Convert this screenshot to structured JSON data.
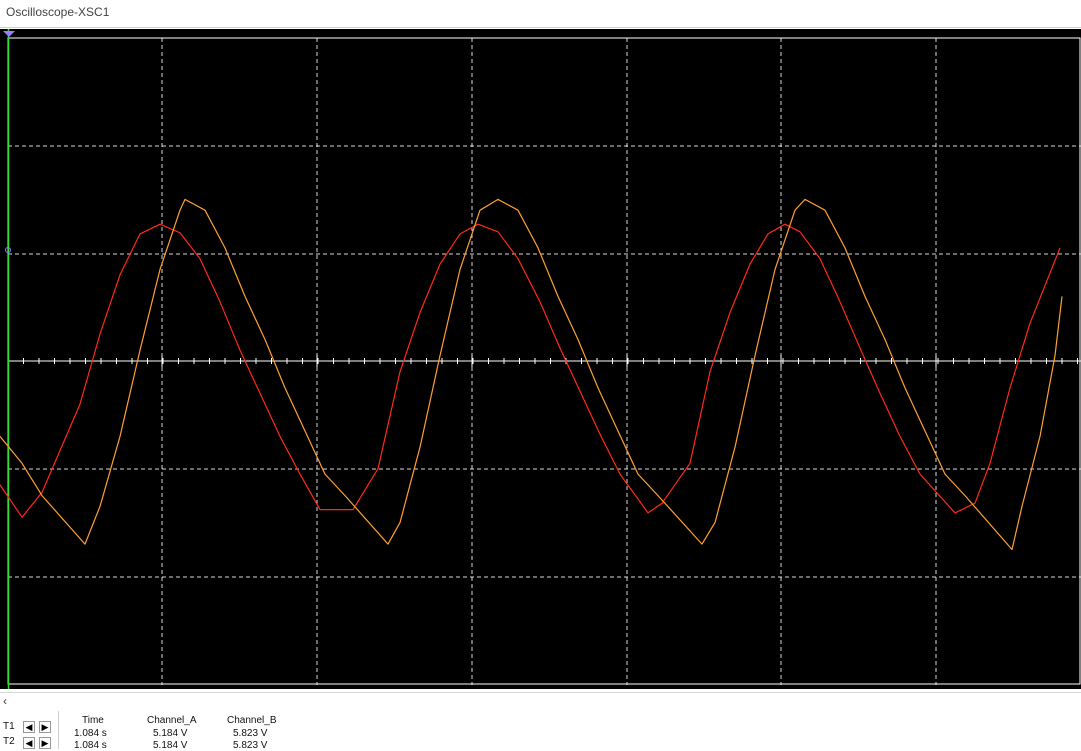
{
  "window": {
    "title": "Oscilloscope-XSC1"
  },
  "scope": {
    "background": "#000000",
    "grid_color": "#ffffff",
    "trace_a_color": "#ff2a1a",
    "trace_b_color": "#ffa030",
    "cursor_t1_color": "#33dd33",
    "trigger_marker_color": "#9a7dff"
  },
  "chart_data": {
    "type": "line",
    "grid": true,
    "divisions": {
      "x": 7,
      "y": 6
    },
    "series": [
      {
        "values": [
          -1.15,
          -1.45,
          -1.22,
          -0.4,
          0.25,
          0.8,
          1.18,
          1.27,
          1.19,
          0.95,
          0.55,
          0.1,
          -0.3,
          -0.7,
          -1.05,
          -1.38,
          -1.38,
          -1.0,
          -0.1,
          0.45,
          0.9,
          1.18,
          1.27,
          1.2,
          0.95,
          0.55,
          0.12,
          -0.28,
          -0.68,
          -1.05,
          -1.41,
          -1.32,
          -0.95,
          -0.1,
          0.45,
          0.9,
          1.18,
          1.27,
          1.2,
          0.95,
          0.55,
          0.12,
          -0.3,
          -0.7,
          -1.05,
          -1.41,
          -1.32,
          -0.95,
          -0.25,
          0.35,
          1.05
        ],
        "x": [
          0,
          22,
          42,
          80,
          100,
          120,
          140,
          160,
          180,
          200,
          220,
          240,
          260,
          280,
          300,
          320,
          353,
          378,
          400,
          420,
          440,
          460,
          478,
          498,
          518,
          540,
          560,
          580,
          600,
          620,
          648,
          662,
          690,
          710,
          730,
          750,
          768,
          785,
          800,
          820,
          840,
          860,
          880,
          900,
          920,
          955,
          975,
          990,
          1010,
          1030,
          1060
        ]
      },
      {
        "values": [
          -0.7,
          -0.95,
          -1.25,
          -1.7,
          -1.35,
          -0.7,
          0.1,
          0.85,
          1.4,
          1.5,
          1.4,
          1.05,
          0.6,
          0.2,
          -0.25,
          -0.65,
          -1.05,
          -1.25,
          -1.7,
          -1.5,
          -0.8,
          0.05,
          0.85,
          1.4,
          1.5,
          1.4,
          1.05,
          0.6,
          0.2,
          -0.25,
          -0.65,
          -1.05,
          -1.25,
          -1.7,
          -1.5,
          -0.8,
          0.05,
          0.85,
          1.4,
          1.5,
          1.4,
          1.05,
          0.6,
          0.2,
          -0.25,
          -0.65,
          -1.05,
          -1.25,
          -1.75,
          -1.35,
          -0.7,
          0.05,
          0.6
        ],
        "x": [
          0,
          22,
          42,
          85,
          100,
          120,
          140,
          160,
          180,
          185,
          205,
          225,
          245,
          265,
          285,
          305,
          325,
          345,
          388,
          400,
          420,
          440,
          460,
          480,
          498,
          518,
          538,
          558,
          578,
          598,
          618,
          638,
          658,
          702,
          715,
          735,
          755,
          775,
          795,
          805,
          825,
          845,
          865,
          885,
          905,
          925,
          945,
          965,
          1012,
          1022,
          1040,
          1055,
          1062
        ]
      }
    ]
  },
  "readout": {
    "rows": [
      {
        "label": "T1",
        "time": "1.084 s",
        "channel_a": "5.184 V",
        "channel_b": "5.823 V"
      },
      {
        "label": "T2",
        "time": "1.084 s",
        "channel_a": "5.184 V",
        "channel_b": "5.823 V"
      }
    ],
    "headers": {
      "time": "Time",
      "channel_a": "Channel_A",
      "channel_b": "Channel_B"
    },
    "nav_left_icon": "arrow-left-icon",
    "nav_right_icon": "arrow-right-icon"
  },
  "scrollbar": {
    "left_icon": "scroll-left-icon"
  }
}
